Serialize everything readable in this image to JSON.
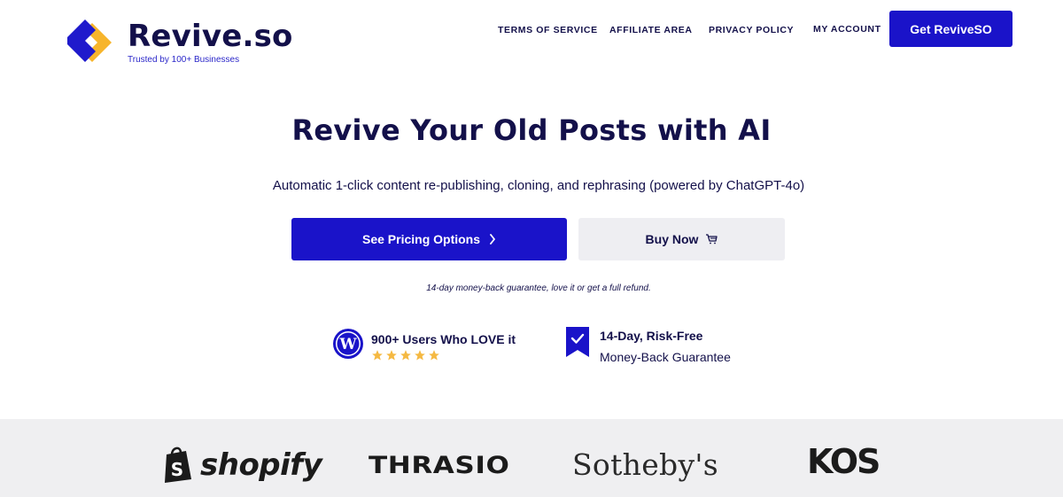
{
  "header": {
    "logo_name": "Revive.so",
    "logo_tagline": "Trusted by 100+ Businesses",
    "nav": [
      {
        "label": "TERMS OF SERVICE"
      },
      {
        "label": "AFFILIATE AREA"
      },
      {
        "label": "PRIVACY POLICY"
      },
      {
        "label": "MY ACCOUNT"
      }
    ],
    "cta_label": "Get ReviveSO"
  },
  "hero": {
    "title": "Revive Your Old Posts with AI",
    "subtitle": "Automatic 1-click content re-publishing, cloning, and rephrasing (powered by ChatGPT-4o)",
    "primary_button": "See Pricing Options",
    "secondary_button": "Buy Now",
    "guarantee_note": "14-day money-back guarantee, love it or get a full refund."
  },
  "badges": {
    "users": {
      "title": "900+ Users Who LOVE it",
      "rating_stars": 5,
      "icon": "wordpress-icon"
    },
    "refund": {
      "title": "14-Day, Risk-Free",
      "subtitle": "Money-Back Guarantee",
      "icon": "check-ribbon-icon"
    }
  },
  "brands": {
    "shopify": "shopify",
    "thrasio": "THRASIO",
    "sothebys": "Sotheby's",
    "kos": "KOS"
  },
  "colors": {
    "primary": "#1a13c9",
    "dark_text": "#13104a",
    "logo_yellow": "#f7b52c",
    "logo_blue": "#1f1acc",
    "star": "#f5b942",
    "secondary_button_bg": "#eeeef2",
    "logos_strip_bg": "#efeff1"
  }
}
